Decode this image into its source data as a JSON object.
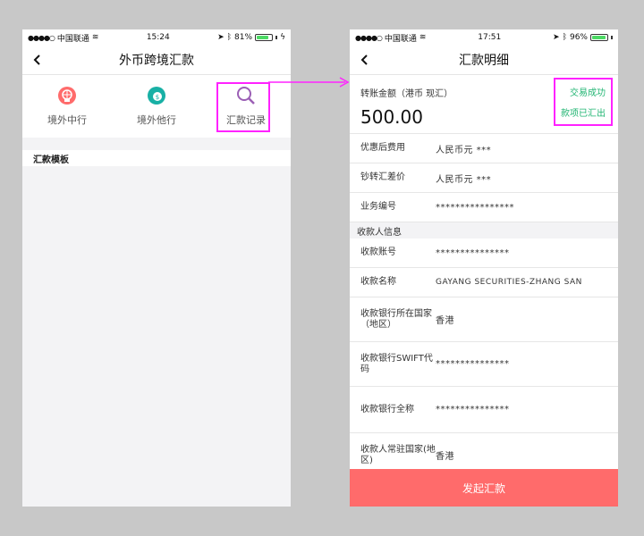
{
  "left": {
    "status": {
      "carrier": "中国联通",
      "time": "15:24",
      "battery": "81%",
      "battery_level": 0.81
    },
    "nav_title": "外币跨境汇款",
    "tiles": [
      {
        "label": "境外中行",
        "color": "#ff6b6b"
      },
      {
        "label": "境外他行",
        "color": "#18b0a5"
      },
      {
        "label": "汇款记录",
        "color": "#9b5fb5"
      }
    ],
    "section": "汇款模板"
  },
  "right": {
    "status": {
      "carrier": "中国联通",
      "time": "17:51",
      "battery": "96%",
      "battery_level": 0.96
    },
    "nav_title": "汇款明细",
    "amount_label": "转账金额（港币 现汇）",
    "amount_value": "500.00",
    "status_1": "交易成功",
    "status_2": "款项已汇出",
    "rows_top": [
      {
        "label": "优惠后费用",
        "value": "人民币元 ***"
      },
      {
        "label": "钞转汇差价",
        "value": "人民币元 ***"
      },
      {
        "label": "业务编号",
        "value": "****************"
      }
    ],
    "group_title": "收款人信息",
    "rows_bottom": [
      {
        "label": "收款账号",
        "value": "***************"
      },
      {
        "label": "收款名称",
        "value": "GAYANG SECURITIES-ZHANG SAN"
      },
      {
        "label": "收款银行所在国家（地区）",
        "value": "香港"
      },
      {
        "label": "收款银行SWIFT代码",
        "value": "***************"
      },
      {
        "label": "收款银行全称",
        "value": "***************"
      },
      {
        "label": "收款人常驻国家(地区)",
        "value": "香港"
      }
    ],
    "button": "发起汇款"
  },
  "colors": {
    "accent": "#ff6b6b",
    "success": "#22b573",
    "highlight": "#ff22ff"
  }
}
